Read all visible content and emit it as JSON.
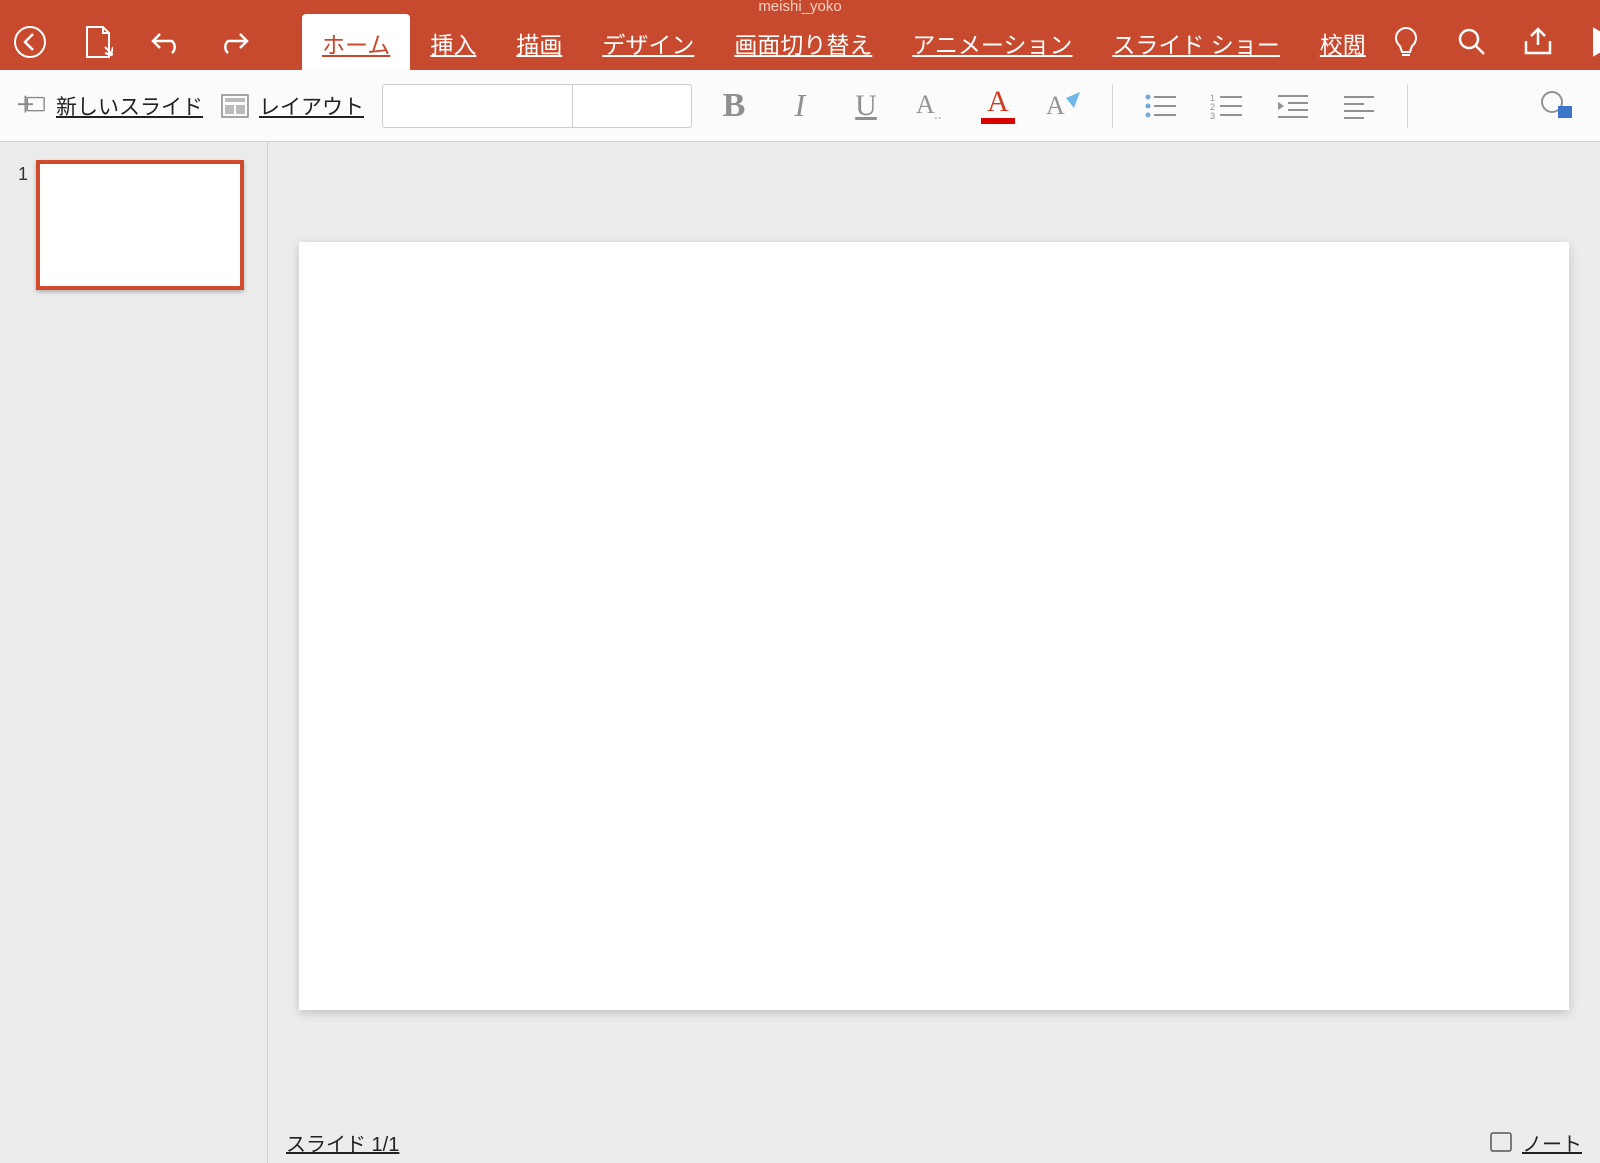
{
  "title": "meishi_yoko",
  "tabs": [
    {
      "label": "ホーム",
      "active": true
    },
    {
      "label": "挿入",
      "active": false
    },
    {
      "label": "描画",
      "active": false
    },
    {
      "label": "デザイン",
      "active": false
    },
    {
      "label": "画面切り替え",
      "active": false
    },
    {
      "label": "アニメーション",
      "active": false
    },
    {
      "label": "スライド ショー",
      "active": false
    },
    {
      "label": "校閲",
      "active": false
    }
  ],
  "ribbon": {
    "new_slide_label": "新しいスライド",
    "layout_label": "レイアウト",
    "font_name": "",
    "font_size": "",
    "font_color": "#d90000"
  },
  "slides": [
    {
      "number": "1"
    }
  ],
  "status": {
    "slide_counter": "スライド 1/1",
    "notes_label": "ノート"
  }
}
